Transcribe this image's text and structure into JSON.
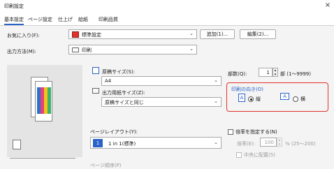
{
  "window": {
    "title": "印刷設定",
    "close_glyph": "×"
  },
  "tabs": [
    {
      "label": "基本設定"
    },
    {
      "label": "ページ設定"
    },
    {
      "label": "仕上げ"
    },
    {
      "label": "給紙"
    },
    {
      "label": "印刷品質"
    }
  ],
  "favorites": {
    "label": "お気に入り(F):",
    "value": "標準設定",
    "add_label": "追加(1)...",
    "edit_label": "編集(2)..."
  },
  "output": {
    "label": "出力方法(M):",
    "value": "印刷"
  },
  "original_size": {
    "label": "原稿サイズ(S):",
    "value": "A4"
  },
  "output_size": {
    "label": "出力用紙サイズ(Z):",
    "value": "原稿サイズと同じ"
  },
  "copies": {
    "label": "部数(Q):",
    "value": "1",
    "range": "部 (1〜9999)"
  },
  "orientation": {
    "label": "印刷の向き(O)",
    "portrait_label": "縦",
    "landscape_label": "横",
    "selected": "portrait"
  },
  "page_layout": {
    "label": "ページレイアウト(Y):",
    "value": "1 in 1(標準)",
    "number": "1"
  },
  "scaling": {
    "label": "倍率を指定する(N)",
    "ratio_label": "倍率(E):",
    "ratio_value": "100",
    "ratio_range": "% (25〜200)",
    "center_label": "中央に配置(5)"
  },
  "page_order_label": "ページ順序(P)",
  "icons": [
    "close-icon",
    "favorite-icon",
    "printer-icon",
    "original-size-icon",
    "output-size-icon",
    "portrait-icon",
    "landscape-icon",
    "layout-icon"
  ],
  "colors": {
    "accent": "#2a62c9",
    "highlight": "#e0322b"
  }
}
